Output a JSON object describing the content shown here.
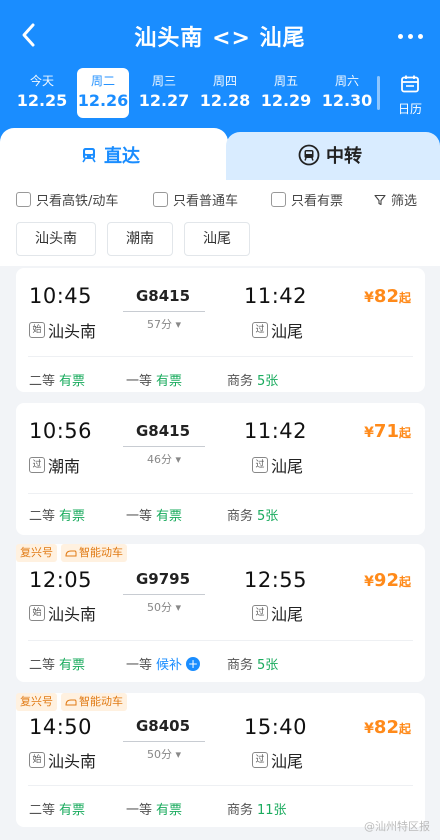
{
  "header": {
    "title": "汕头南 <> 汕尾",
    "calendar_label": "日历"
  },
  "dates": [
    {
      "weekday": "今天",
      "date": "12.25",
      "active": false
    },
    {
      "weekday": "周二",
      "date": "12.26",
      "active": true
    },
    {
      "weekday": "周三",
      "date": "12.27",
      "active": false
    },
    {
      "weekday": "周四",
      "date": "12.28",
      "active": false
    },
    {
      "weekday": "周五",
      "date": "12.29",
      "active": false
    },
    {
      "weekday": "周六",
      "date": "12.30",
      "active": false
    }
  ],
  "tabs": {
    "direct": "直达",
    "transfer": "中转"
  },
  "filters": {
    "hsr_only": "只看高铁/动车",
    "normal_only": "只看普通车",
    "available_only": "只看有票",
    "filter": "筛选"
  },
  "stations": [
    "汕头南",
    "潮南",
    "汕尾"
  ],
  "trains": [
    {
      "tags": [],
      "dep": "10:45",
      "arr": "11:42",
      "train_no": "G8415",
      "duration": "57分",
      "dep_badge": "始",
      "dep_station": "汕头南",
      "arr_badge": "过",
      "arr_station": "汕尾",
      "price_symbol": "¥",
      "price": "82",
      "price_suffix": "起",
      "seats": [
        {
          "class": "二等",
          "status": "有票"
        },
        {
          "class": "一等",
          "status": "有票"
        },
        {
          "class": "商务",
          "status": "5张"
        }
      ]
    },
    {
      "tags": [],
      "dep": "10:56",
      "arr": "11:42",
      "train_no": "G8415",
      "duration": "46分",
      "dep_badge": "过",
      "dep_station": "潮南",
      "arr_badge": "过",
      "arr_station": "汕尾",
      "price_symbol": "¥",
      "price": "71",
      "price_suffix": "起",
      "seats": [
        {
          "class": "二等",
          "status": "有票"
        },
        {
          "class": "一等",
          "status": "有票"
        },
        {
          "class": "商务",
          "status": "5张"
        }
      ]
    },
    {
      "tags": [
        "复兴号",
        "智能动车"
      ],
      "dep": "12:05",
      "arr": "12:55",
      "train_no": "G9795",
      "duration": "50分",
      "dep_badge": "始",
      "dep_station": "汕头南",
      "arr_badge": "过",
      "arr_station": "汕尾",
      "price_symbol": "¥",
      "price": "92",
      "price_suffix": "起",
      "seats": [
        {
          "class": "二等",
          "status": "有票"
        },
        {
          "class": "一等",
          "status": "候补"
        },
        {
          "class": "商务",
          "status": "5张"
        }
      ]
    },
    {
      "tags": [
        "复兴号",
        "智能动车"
      ],
      "dep": "14:50",
      "arr": "15:40",
      "train_no": "G8405",
      "duration": "50分",
      "dep_badge": "始",
      "dep_station": "汕头南",
      "arr_badge": "过",
      "arr_station": "汕尾",
      "price_symbol": "¥",
      "price": "82",
      "price_suffix": "起",
      "seats": [
        {
          "class": "二等",
          "status": "有票"
        },
        {
          "class": "一等",
          "status": "有票"
        },
        {
          "class": "商务",
          "status": "11张"
        }
      ]
    }
  ],
  "watermark": "@汕州特区报",
  "colors": {
    "primary": "#1a8dff",
    "price": "#ff8a1a",
    "available": "#1aab5e"
  }
}
